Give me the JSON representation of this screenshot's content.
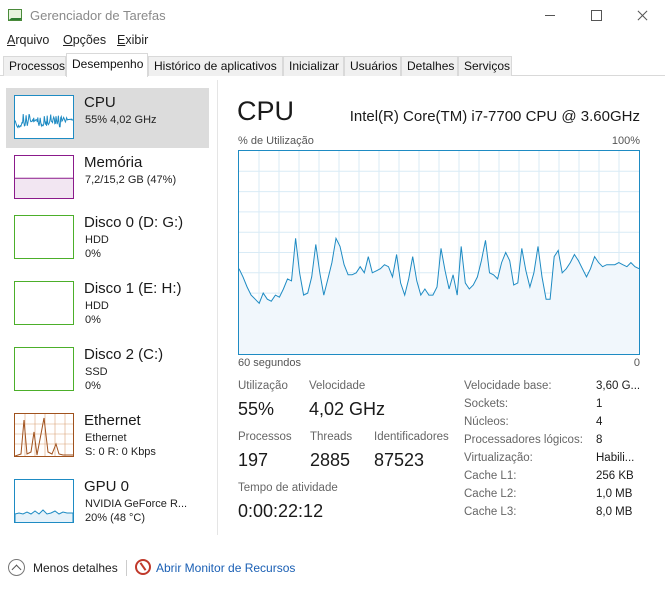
{
  "window": {
    "title": "Gerenciador de Tarefas"
  },
  "menu": [
    "Arquivo",
    "Opções",
    "Exibir"
  ],
  "tabs": [
    "Processos",
    "Desempenho",
    "Histórico de aplicativos",
    "Inicializar",
    "Usuários",
    "Detalhes",
    "Serviços"
  ],
  "active_tab": "Desempenho",
  "sidebar": [
    {
      "title": "CPU",
      "sub1": "55% 4,02 GHz",
      "sub2": "",
      "color": "#1e8bc3",
      "selected": true
    },
    {
      "title": "Memória",
      "sub1": "7,2/15,2 GB (47%)",
      "sub2": "",
      "color": "#8b1a8b",
      "level": 0.47
    },
    {
      "title": "Disco 0 (D: G:)",
      "sub1": "HDD",
      "sub2": "0%",
      "color": "#4caf2a"
    },
    {
      "title": "Disco 1 (E: H:)",
      "sub1": "HDD",
      "sub2": "0%",
      "color": "#4caf2a"
    },
    {
      "title": "Disco 2 (C:)",
      "sub1": "SSD",
      "sub2": "0%",
      "color": "#4caf2a"
    },
    {
      "title": "Ethernet",
      "sub1": "Ethernet",
      "sub2": "S: 0 R: 0 Kbps",
      "color": "#a0521e"
    },
    {
      "title": "GPU 0",
      "sub1": "NVIDIA GeForce R...",
      "sub2": "20% (48 °C)",
      "color": "#1e8bc3"
    }
  ],
  "cpu": {
    "heading": "CPU",
    "model": "Intel(R) Core(TM) i7-7700 CPU @ 3.60GHz",
    "util_label": "% de Utilização",
    "util_max": "100%",
    "x_left": "60 segundos",
    "x_right": "0",
    "history": [
      42,
      38,
      33,
      29,
      27,
      25,
      30,
      27,
      26,
      29,
      28,
      32,
      37,
      36,
      57,
      40,
      29,
      30,
      38,
      54,
      40,
      29,
      37,
      45,
      57,
      53,
      44,
      39,
      39,
      40,
      43,
      40,
      48,
      40,
      41,
      42,
      44,
      43,
      38,
      49,
      35,
      29,
      37,
      48,
      36,
      29,
      32,
      29,
      29,
      33,
      52,
      41,
      32,
      39,
      29,
      53,
      35,
      32,
      34,
      38,
      46,
      56,
      40,
      39,
      37,
      45,
      50,
      46,
      34,
      35,
      52,
      41,
      33,
      40,
      53,
      38,
      27,
      27,
      48,
      51,
      40,
      42,
      45,
      49,
      46,
      42,
      38,
      42,
      48,
      45,
      43,
      44,
      44,
      44,
      45,
      44,
      43,
      45,
      43,
      42
    ],
    "stats": [
      {
        "label": "Utilização",
        "value": "55%"
      },
      {
        "label": "Velocidade",
        "value": "4,02 GHz"
      },
      {
        "label": "Processos",
        "value": "197"
      },
      {
        "label": "Threads",
        "value": "2885"
      },
      {
        "label": "Identificadores",
        "value": "87523"
      },
      {
        "label": "Tempo de atividade",
        "value": "0:00:22:12"
      }
    ],
    "specs": [
      {
        "label": "Velocidade base:",
        "value": "3,60 G..."
      },
      {
        "label": "Sockets:",
        "value": "1"
      },
      {
        "label": "Núcleos:",
        "value": "4"
      },
      {
        "label": "Processadores lógicos:",
        "value": "8"
      },
      {
        "label": "Virtualização:",
        "value": "Habili..."
      },
      {
        "label": "Cache L1:",
        "value": "256 KB"
      },
      {
        "label": "Cache L2:",
        "value": "1,0 MB"
      },
      {
        "label": "Cache L3:",
        "value": "8,0 MB"
      }
    ]
  },
  "footer": {
    "less_details": "Menos detalhes",
    "monitor_link": "Abrir Monitor de Recursos"
  }
}
